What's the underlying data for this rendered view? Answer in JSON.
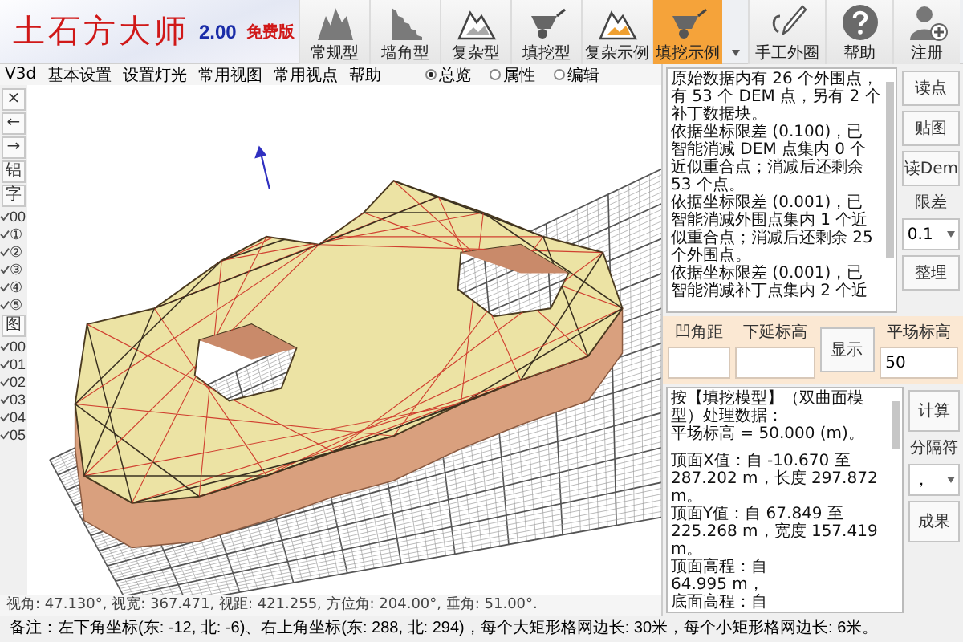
{
  "logo": {
    "title": "土石方大师",
    "version": "2.00",
    "edition": "免费版"
  },
  "tools": [
    {
      "label": "常规型",
      "selected": false
    },
    {
      "label": "墙角型",
      "selected": false
    },
    {
      "label": "复杂型",
      "selected": false
    },
    {
      "label": "填挖型",
      "selected": false
    },
    {
      "label": "复杂示例",
      "selected": false
    },
    {
      "label": "填挖示例",
      "selected": true
    }
  ],
  "extra_tools": [
    {
      "label": "手工外圈"
    },
    {
      "label": "帮助"
    },
    {
      "label": "注册"
    }
  ],
  "menu": [
    "V3d",
    "基本设置",
    "设置灯光",
    "常用视图",
    "常用视点",
    "帮助"
  ],
  "view_modes": [
    {
      "label": "总览",
      "selected": true
    },
    {
      "label": "属性",
      "selected": false
    },
    {
      "label": "编辑",
      "selected": false
    }
  ],
  "side_buttons": [
    "×",
    "←",
    "→",
    "铝",
    "字"
  ],
  "layers_a": [
    {
      "label": "00",
      "checked": true
    },
    {
      "label": "①",
      "checked": true
    },
    {
      "label": "②",
      "checked": true
    },
    {
      "label": "③",
      "checked": true
    },
    {
      "label": "④",
      "checked": true
    },
    {
      "label": "⑤",
      "checked": true
    }
  ],
  "side_button_b": "图",
  "layers_b": [
    {
      "label": "00",
      "checked": true
    },
    {
      "label": "01",
      "checked": true
    },
    {
      "label": "02",
      "checked": true
    },
    {
      "label": "03",
      "checked": true
    },
    {
      "label": "04",
      "checked": true
    },
    {
      "label": "05",
      "checked": true
    }
  ],
  "view_status": "视角: 47.130°, 视宽: 367.471, 视距: 421.255, 方位角: 204.00°, 垂角: 51.00°.",
  "note": "备注：左下角坐标(东: -12, 北: -6)、右上角坐标(东: 288, 北: 294)，每个大矩形格网边长: 30米，每个小矩形格网边长: 6米。",
  "log_top": {
    "blocks": [
      [
        "原始数据内有 26 个外围点，",
        "有 53 个 DEM 点，另有 2 个",
        "补丁数据块。",
        "依据坐标限差 (0.100)，已",
        "智能消减 DEM 点集内 0 个",
        "近似重合点；消减后还剩余",
        "53 个点。",
        "依据坐标限差 (0.001)，已",
        "智能消减外围点集内 1 个近",
        "似重合点；消减后还剩余 25",
        "个外围点。",
        "依据坐标限差 (0.001)，已",
        "智能消减补丁点集内 2 个近"
      ]
    ]
  },
  "top_buttons": [
    "读点",
    "贴图",
    "读Dem"
  ],
  "tolerance": {
    "label": "限差",
    "value": "0.1"
  },
  "tidy_button": "整理",
  "params": {
    "corner_label": "凹角距",
    "extend_label": "下延标高",
    "show_button": "显示",
    "level_label": "平场标高",
    "level_value": "50"
  },
  "log_bottom": {
    "blocks": [
      [
        "按【填挖模型】（双曲面模",
        "型）处理数据：",
        "平场标高 = 50.000 (m)。"
      ],
      [
        "顶面X值：自 -10.670 至",
        "287.202 m，长度 297.872",
        "m。",
        "顶面Y值：自 67.849 至",
        "225.268 m，宽度 157.419",
        "m。",
        "顶面高程：自",
        "64.995 m，",
        "底面高程：自"
      ]
    ]
  },
  "calc_button": "计算",
  "separator": {
    "label": "分隔符",
    "value": "，"
  },
  "result_button": "成果"
}
